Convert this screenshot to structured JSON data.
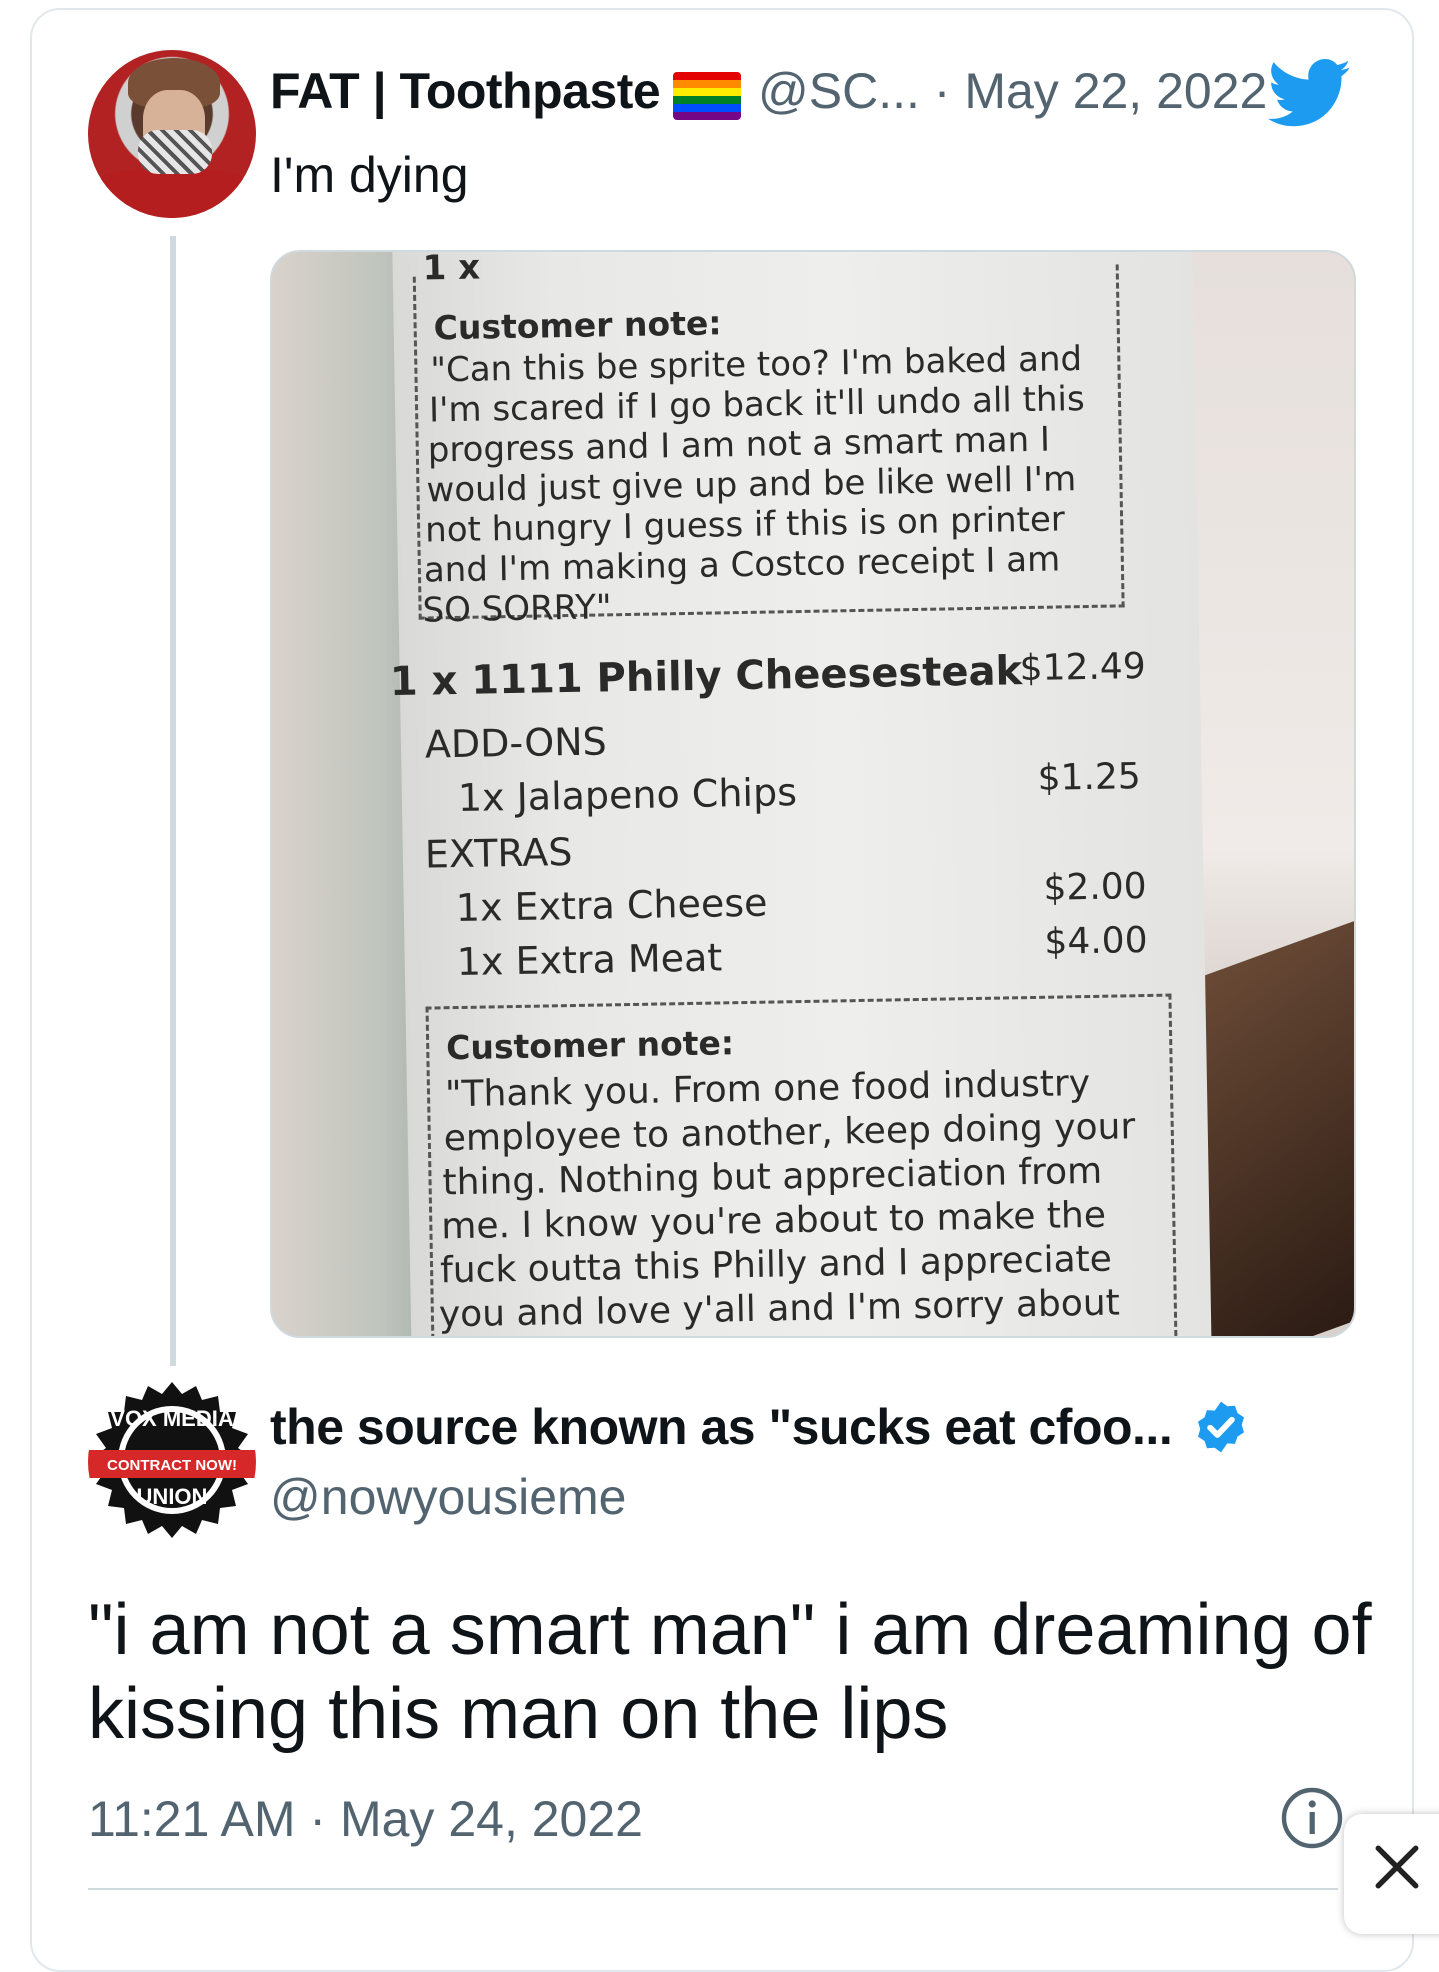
{
  "quoted_tweet": {
    "display_name": "FAT | Toothpaste",
    "handle": "@SC...",
    "date": "· May 22, 2022",
    "text": "I'm dying",
    "icon_flag": "rainbow-flag-emoji",
    "icon_platform": "twitter-bird-icon",
    "receipt": {
      "top_cut": "1 x",
      "note1_title": "Customer note:",
      "note1_lines": [
        "\"Can this be sprite too? I'm baked and",
        "I'm scared if I go back it'll undo all this",
        "progress and I am not a smart man I",
        "would just give up and be like well I'm",
        "not hungry I guess if this is on printer",
        "and I'm making a Costco receipt I am",
        "SO SORRY\""
      ],
      "item_main": "1 x 1111 Philly Cheesesteak",
      "item_main_price": "$12.49",
      "addons_header": "ADD-ONS",
      "addon_1": "1x Jalapeno Chips",
      "addon_1_price": "$1.25",
      "extras_header": "EXTRAS",
      "extra_1": "1x Extra Cheese",
      "extra_1_price": "$2.00",
      "extra_2": "1x Extra Meat",
      "extra_2_price": "$4.00",
      "note2_title": "Customer note:",
      "note2_lines": [
        "\"Thank you. From one food industry",
        "employee to another, keep doing your",
        "thing. Nothing but appreciation from",
        "me. I know you're about to make the",
        "fuck outta this Philly and I appreciate",
        "you and love y'all and I'm sorry about"
      ]
    }
  },
  "main_tweet": {
    "avatar_text_top": "VOX MEDIA",
    "avatar_text_mid": "CONTRACT NOW!",
    "avatar_text_bottom": "UNION",
    "display_name": "the source known as \"sucks eat cfoo...",
    "handle": "@nowyousieme",
    "text_lines": [
      "\"i am not a smart man\" i am dreaming of",
      "kissing this man on the lips"
    ],
    "timestamp": "11:21 AM · May 24, 2022",
    "info_icon": "info-icon",
    "close_icon": "close-icon"
  },
  "colors": {
    "text_primary": "#0f1419",
    "text_secondary": "#536471",
    "twitter_blue": "#1d9bf0",
    "border": "#cfd9de"
  }
}
